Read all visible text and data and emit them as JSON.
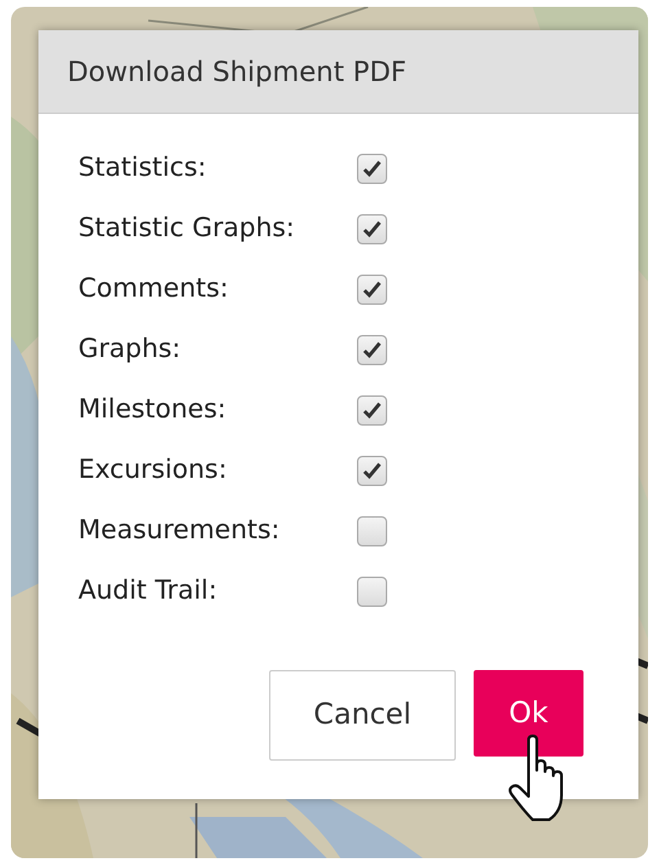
{
  "dialog": {
    "title": "Download Shipment PDF"
  },
  "options": [
    {
      "label": "Statistics:",
      "checked": true
    },
    {
      "label": "Statistic Graphs:",
      "checked": true
    },
    {
      "label": "Comments:",
      "checked": true
    },
    {
      "label": "Graphs:",
      "checked": true
    },
    {
      "label": "Milestones:",
      "checked": true
    },
    {
      "label": "Excursions:",
      "checked": true
    },
    {
      "label": "Measurements:",
      "checked": false
    },
    {
      "label": "Audit Trail:",
      "checked": false
    }
  ],
  "buttons": [
    {
      "label": "Cancel",
      "kind": "secondary"
    },
    {
      "label": "Ok",
      "kind": "primary"
    }
  ]
}
